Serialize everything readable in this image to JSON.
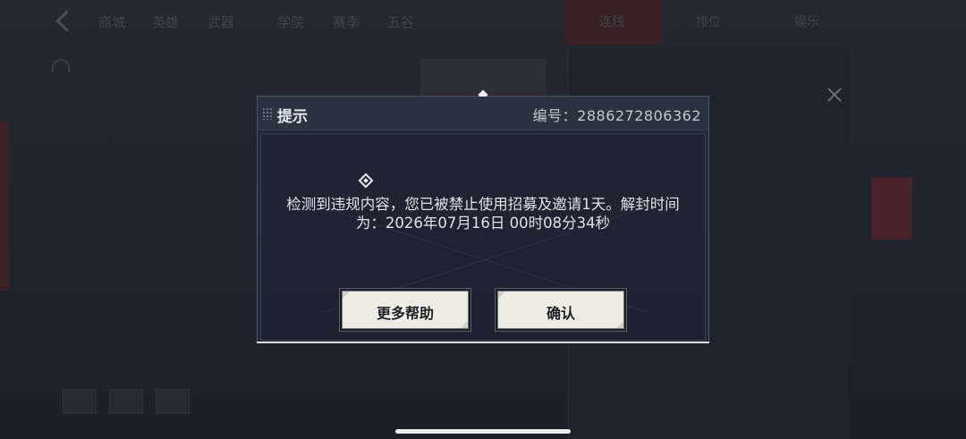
{
  "background": {
    "nav_tabs": [
      "商城",
      "英雄",
      "武器",
      "学院",
      "赛季",
      "五谷"
    ],
    "right_tabs": [
      "连线",
      "排位",
      "娱乐"
    ]
  },
  "dialog": {
    "title": "提示",
    "serial_label": "编号：",
    "serial_number": "2886272806362",
    "message_line1": "检测到违规内容，您已被禁止使用招募及邀请1天。解封时间",
    "message_line2": "为：2026年07月16日 00时08分34秒",
    "help_button": "更多帮助",
    "confirm_button": "确认"
  },
  "colors": {
    "dialog_bg": "#222936",
    "titlebar_bg": "#2b3240",
    "button_bg": "#efece4",
    "accent_red": "#472327"
  },
  "icons": [
    "back-chevron-icon",
    "grip-icon",
    "diamond-marker-icon",
    "gem-icon",
    "close-icon"
  ]
}
